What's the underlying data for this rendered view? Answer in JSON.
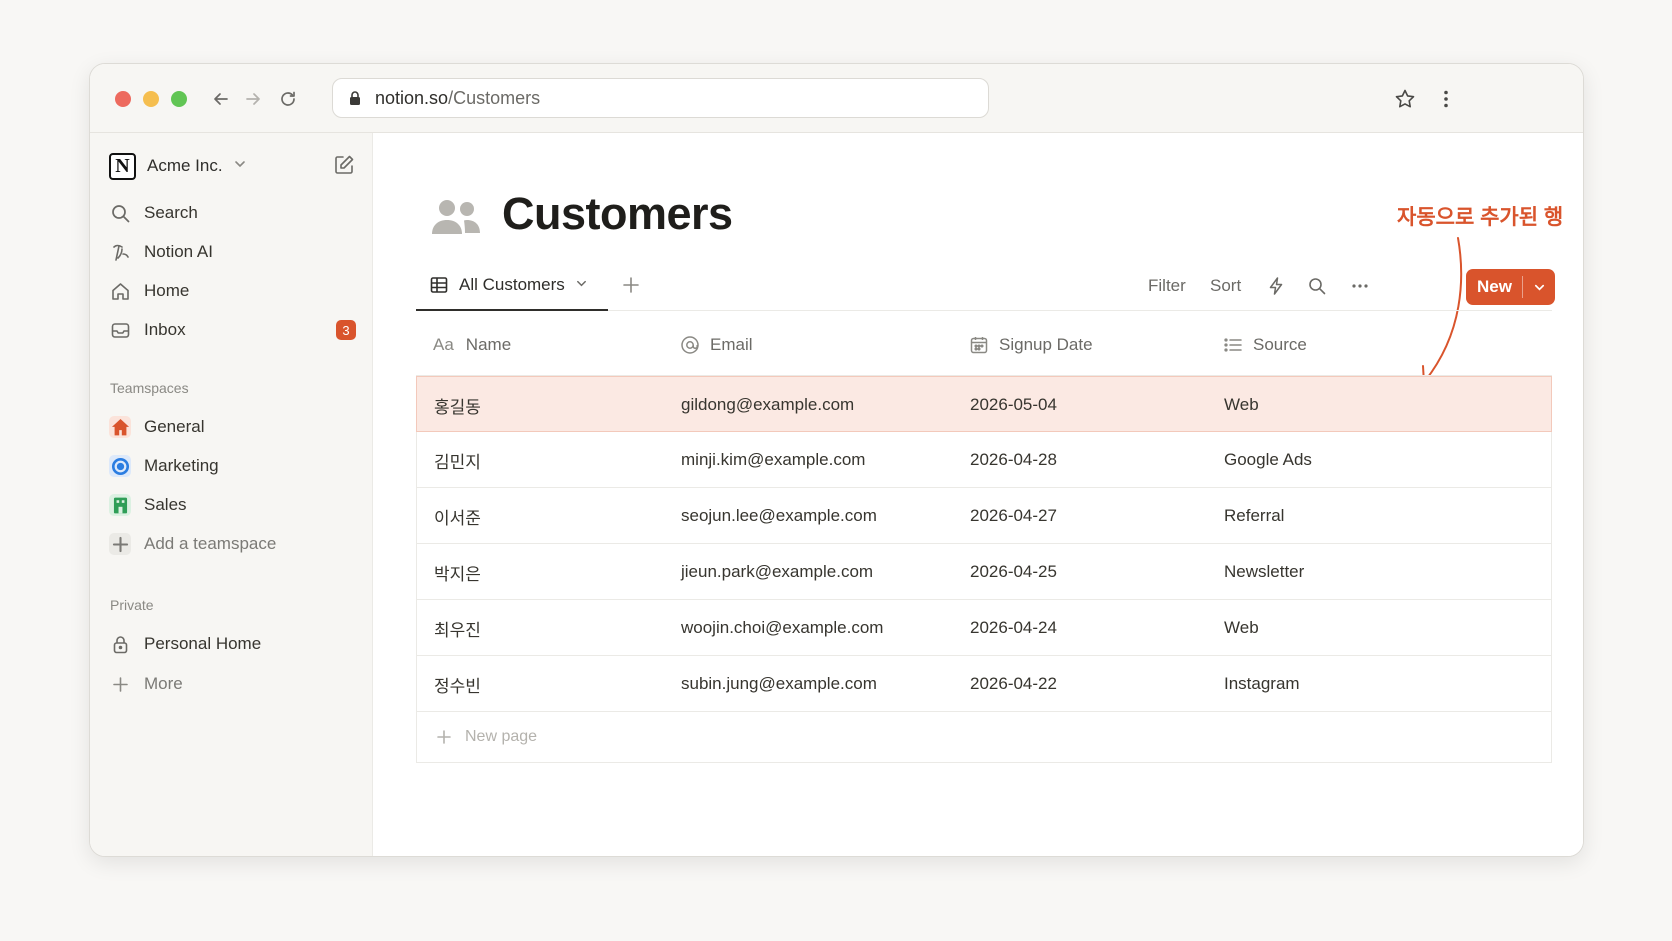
{
  "browser": {
    "url_domain": "notion.so",
    "url_path": "/Customers"
  },
  "sidebar": {
    "workspace_name": "Acme Inc.",
    "logo_letter": "N",
    "nav": [
      {
        "label": "Search",
        "icon": "search-icon"
      },
      {
        "label": "Notion AI",
        "icon": "notion-ai-icon"
      },
      {
        "label": "Home",
        "icon": "home-icon"
      },
      {
        "label": "Inbox",
        "icon": "inbox-icon",
        "badge": "3"
      }
    ],
    "teamspaces_label": "Teamspaces",
    "teamspaces": [
      {
        "label": "General",
        "icon": "house-icon",
        "color": "#d9542c"
      },
      {
        "label": "Marketing",
        "icon": "target-icon",
        "color": "#2b7de1"
      },
      {
        "label": "Sales",
        "icon": "building-icon",
        "color": "#2f9e57"
      }
    ],
    "add_teamspace": "Add a teamspace",
    "private_label": "Private",
    "private": [
      {
        "label": "Personal Home",
        "icon": "lock-icon"
      }
    ],
    "more": "More"
  },
  "page": {
    "title": "Customers",
    "annotation": "자동으로 추가된 행",
    "view_tab": "All Customers",
    "tools": {
      "filter": "Filter",
      "sort": "Sort"
    },
    "new_button": "New"
  },
  "table": {
    "columns": [
      "Name",
      "Email",
      "Signup Date",
      "Source"
    ],
    "name_prefix": "Aa",
    "rows": [
      {
        "name": "홍길동",
        "email": "gildong@example.com",
        "date": "2026-05-04",
        "source": "Web"
      },
      {
        "name": "김민지",
        "email": "minji.kim@example.com",
        "date": "2026-04-28",
        "source": "Google Ads"
      },
      {
        "name": "이서준",
        "email": "seojun.lee@example.com",
        "date": "2026-04-27",
        "source": "Referral"
      },
      {
        "name": "박지은",
        "email": "jieun.park@example.com",
        "date": "2026-04-25",
        "source": "Newsletter"
      },
      {
        "name": "최우진",
        "email": "woojin.choi@example.com",
        "date": "2026-04-24",
        "source": "Web"
      },
      {
        "name": "정수빈",
        "email": "subin.jung@example.com",
        "date": "2026-04-22",
        "source": "Instagram"
      }
    ],
    "new_page": "New page"
  },
  "colors": {
    "accent": "#d9542c",
    "highlight_row": "#fbe9e3"
  }
}
